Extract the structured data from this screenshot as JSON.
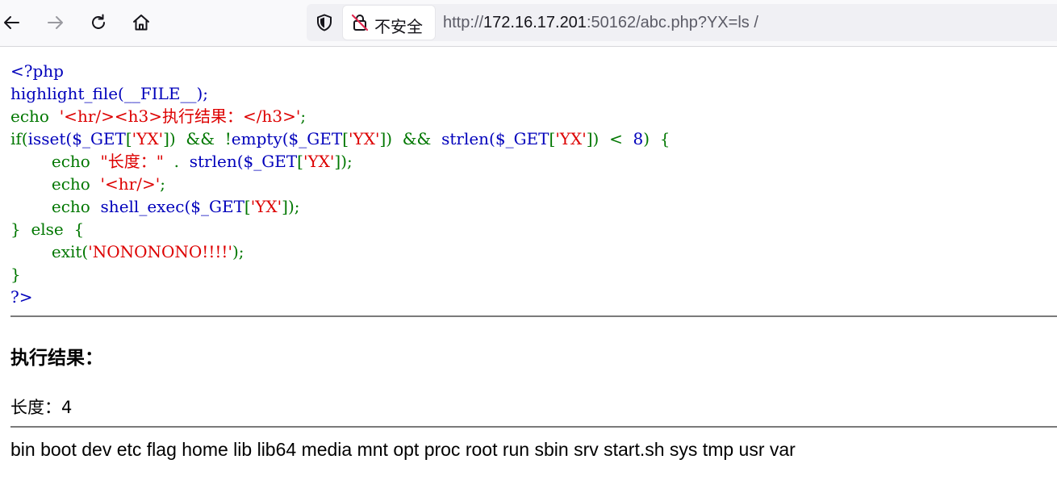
{
  "browser": {
    "security_label": "不安全",
    "url_prefix": "http://",
    "url_host": "172.16.17.201",
    "url_rest": ":50162/abc.php?YX=ls /"
  },
  "source_code": [
    [
      [
        "default",
        "<?php"
      ]
    ],
    [
      [
        "default",
        "highlight_file(__FILE__);"
      ]
    ],
    [
      [
        "keyword",
        "echo  "
      ],
      [
        "string",
        "'<hr/><h3>执行结果：</h3>'"
      ],
      [
        "keyword",
        ";"
      ]
    ],
    [
      [
        "keyword",
        "if("
      ],
      [
        "default",
        "isset("
      ],
      [
        "default",
        "$_GET"
      ],
      [
        "keyword",
        "["
      ],
      [
        "string",
        "'YX'"
      ],
      [
        "keyword",
        "])  &&  !"
      ],
      [
        "default",
        "empty("
      ],
      [
        "default",
        "$_GET"
      ],
      [
        "keyword",
        "["
      ],
      [
        "string",
        "'YX'"
      ],
      [
        "keyword",
        "])  &&  "
      ],
      [
        "default",
        "strlen("
      ],
      [
        "default",
        "$_GET"
      ],
      [
        "keyword",
        "["
      ],
      [
        "string",
        "'YX'"
      ],
      [
        "keyword",
        "])  <  "
      ],
      [
        "default",
        "8"
      ],
      [
        "keyword",
        ")  {"
      ]
    ],
    [
      [
        "keyword",
        "        echo  "
      ],
      [
        "string",
        "\"长度：\""
      ],
      [
        "keyword",
        "  .  "
      ],
      [
        "default",
        "strlen("
      ],
      [
        "default",
        "$_GET"
      ],
      [
        "keyword",
        "["
      ],
      [
        "string",
        "'YX'"
      ],
      [
        "keyword",
        "]);"
      ]
    ],
    [
      [
        "keyword",
        "        echo  "
      ],
      [
        "string",
        "'<hr/>'"
      ],
      [
        "keyword",
        ";"
      ]
    ],
    [
      [
        "keyword",
        "        echo  "
      ],
      [
        "default",
        "shell_exec("
      ],
      [
        "default",
        "$_GET"
      ],
      [
        "keyword",
        "["
      ],
      [
        "string",
        "'YX'"
      ],
      [
        "keyword",
        "]);"
      ]
    ],
    [
      [
        "keyword",
        "}  else  {"
      ]
    ],
    [
      [
        "keyword",
        "        exit("
      ],
      [
        "string",
        "'NONONONO!!!!'"
      ],
      [
        "keyword",
        ");"
      ]
    ],
    [
      [
        "keyword",
        "}"
      ]
    ],
    [
      [
        "default",
        "?>"
      ]
    ]
  ],
  "result": {
    "heading": "执行结果：",
    "length_line": "长度：4",
    "output": "bin boot dev etc flag home lib lib64 media mnt opt proc root run sbin srv start.sh sys tmp usr var"
  },
  "colors": {
    "default": "#0000bb",
    "keyword": "#007700",
    "string": "#dd0000"
  },
  "icons": [
    "back-arrow-icon",
    "forward-arrow-icon",
    "reload-icon",
    "home-icon",
    "shield-icon",
    "insecure-lock-icon"
  ]
}
